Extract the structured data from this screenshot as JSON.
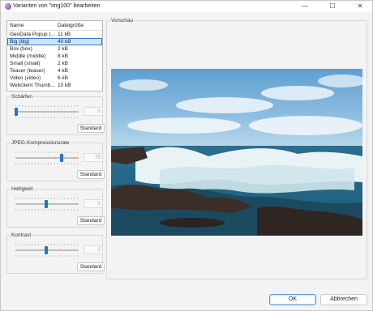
{
  "window": {
    "title": "Varianten von \"img100\" bearbeiten",
    "minimize_glyph": "—",
    "maximize_glyph": "☐",
    "close_glyph": "✕"
  },
  "variants": {
    "headers": {
      "name": "Name",
      "size": "Dateigröße"
    },
    "rows": [
      {
        "name": "GeoData Popup (...",
        "size": "11 kB"
      },
      {
        "name": "Big (big)",
        "size": "40 kB"
      },
      {
        "name": "Box (box)",
        "size": "2 kB"
      },
      {
        "name": "Middle (middle)",
        "size": "8 kB"
      },
      {
        "name": "Small (small)",
        "size": "2 kB"
      },
      {
        "name": "Teaser (teaser)",
        "size": "4 kB"
      },
      {
        "name": "Video (video)",
        "size": "6 kB"
      },
      {
        "name": "Webclient Thumb...",
        "size": "10 kB"
      }
    ],
    "selected_index": 1
  },
  "controls": [
    {
      "label": "Schärfen",
      "value": "0",
      "slider_fraction": 0.0,
      "button": "Standard"
    },
    {
      "label": "JPEG-Kompressionsrate",
      "value": "75",
      "slider_fraction": 0.75,
      "button": "Standard"
    },
    {
      "label": "Helligkeit",
      "value": "0",
      "slider_fraction": 0.5,
      "button": "Standard"
    },
    {
      "label": "Kontrast",
      "value": "0",
      "slider_fraction": 0.5,
      "button": "Standard"
    }
  ],
  "preview": {
    "label": "Vorschau"
  },
  "footer": {
    "ok_label": "OK",
    "cancel_label": "Abbrechen"
  },
  "colors": {
    "accent": "#1f74cc",
    "selection": "#cce4f7"
  }
}
